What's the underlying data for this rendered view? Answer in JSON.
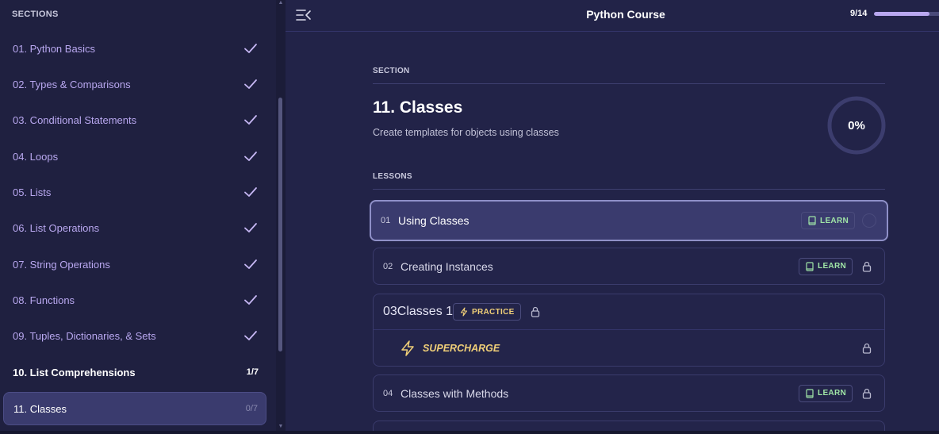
{
  "sidebar": {
    "header": "SECTIONS",
    "items": [
      {
        "label": "01. Python Basics",
        "status": "done"
      },
      {
        "label": "02. Types & Comparisons",
        "status": "done"
      },
      {
        "label": "03. Conditional Statements",
        "status": "done"
      },
      {
        "label": "04. Loops",
        "status": "done"
      },
      {
        "label": "05. Lists",
        "status": "done"
      },
      {
        "label": "06. List Operations",
        "status": "done"
      },
      {
        "label": "07. String Operations",
        "status": "done"
      },
      {
        "label": "08. Functions",
        "status": "done"
      },
      {
        "label": "09. Tuples, Dictionaries, & Sets",
        "status": "done"
      },
      {
        "label": "10. List Comprehensions",
        "status": "current",
        "count": "1/7"
      },
      {
        "label": "11. Classes",
        "status": "active",
        "count": "0/7"
      }
    ]
  },
  "topbar": {
    "title": "Python Course",
    "progress_text": "9/14",
    "progress_fraction": 0.78
  },
  "section": {
    "heading": "SECTION",
    "title": "11. Classes",
    "description": "Create templates for objects using classes",
    "percent": "0%"
  },
  "lessons": {
    "heading": "LESSONS",
    "items": [
      {
        "num": "01",
        "name": "Using Classes",
        "badge": "LEARN",
        "badge_type": "learn",
        "state": "active"
      },
      {
        "num": "02",
        "name": "Creating Instances",
        "badge": "LEARN",
        "badge_type": "learn",
        "state": "locked"
      },
      {
        "num": "03",
        "name": "Classes 1",
        "badge": "PRACTICE",
        "badge_type": "practice",
        "state": "locked",
        "supercharge": "SUPERCHARGE"
      },
      {
        "num": "04",
        "name": "Classes with Methods",
        "badge": "LEARN",
        "badge_type": "learn",
        "state": "locked"
      }
    ]
  },
  "colors": {
    "accent": "#b9a8f0",
    "learn": "#9fe4a6",
    "practice": "#f0cf78",
    "background": "#1f2040"
  }
}
